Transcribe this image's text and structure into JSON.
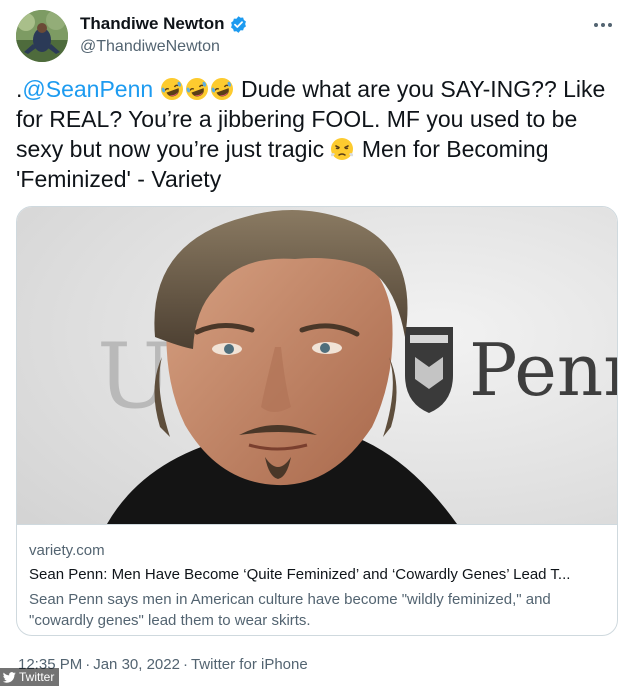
{
  "author": {
    "display_name": "Thandiwe Newton",
    "handle": "@ThandiweNewton",
    "verified": true
  },
  "tweet": {
    "prefix": ".",
    "mention": "@SeanPenn",
    "emoji_laughing": "rolling-on-floor-laughing",
    "text_1": " Dude what are you SAY-ING?? Like for REAL? You’re a jibbering FOOL. MF you used to be sexy but now you’re just tragic ",
    "emoji_angry": "face-with-steam-from-nose",
    "text_2": " Men for Becoming 'Feminized' - Variety"
  },
  "card": {
    "image_alt": "Sean Penn",
    "background_text_1": "UC",
    "background_text_2": "Penn",
    "domain": "variety.com",
    "title": "Sean Penn: Men Have Become ‘Quite Feminized’ and ‘Cowardly Genes’ Lead T...",
    "description": "Sean Penn says men in American culture have become \"wildly feminized,\" and \"cowardly genes\" lead them to wear skirts."
  },
  "footer": {
    "time": "12:35 PM",
    "separator": "·",
    "date": "Jan 30, 2022",
    "source": "Twitter for iPhone"
  },
  "watermark": {
    "label": "Twitter"
  },
  "colors": {
    "link": "#1d9bf0",
    "secondary_text": "#536471",
    "border": "#cfd9de",
    "verified": "#1d9bf0"
  }
}
